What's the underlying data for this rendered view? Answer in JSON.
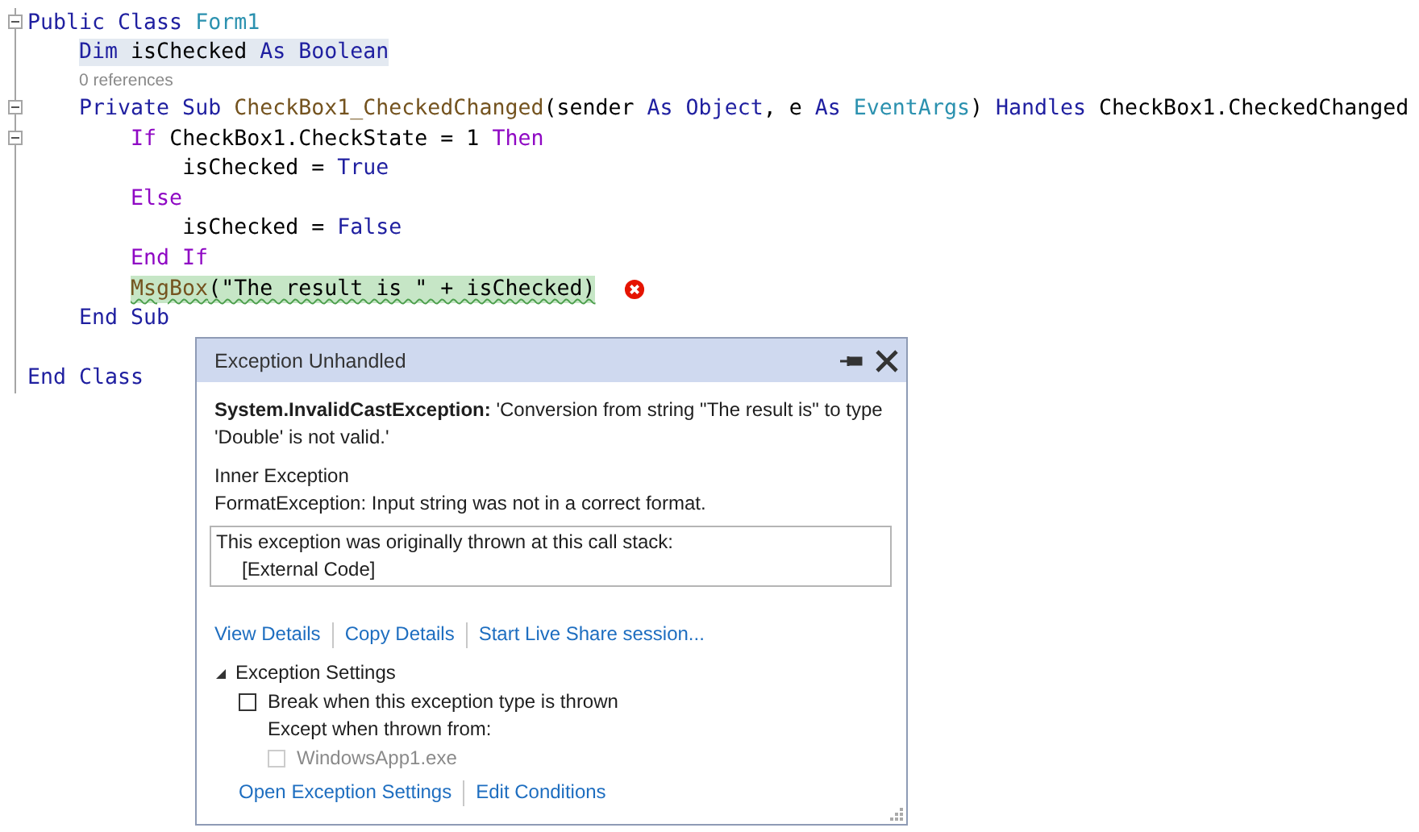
{
  "editor": {
    "lines": [
      {
        "kind": "code",
        "fold": true,
        "tokens": [
          {
            "text": "Public Class ",
            "kind": "keyword"
          },
          {
            "text": "Form1",
            "kind": "type"
          }
        ],
        "children": [
          {
            "kind": "code",
            "reference_highlight": true,
            "tokens": [
              {
                "text": "Dim ",
                "kind": "keyword"
              },
              {
                "text": "isChecked ",
                "kind": "plain"
              },
              {
                "text": "As Boolean",
                "kind": "keyword"
              }
            ]
          },
          {
            "kind": "codelens",
            "text": "0 references"
          },
          {
            "kind": "code",
            "fold": true,
            "tokens": [
              {
                "text": "Private Sub ",
                "kind": "keyword"
              },
              {
                "text": "CheckBox1_CheckedChanged",
                "kind": "method"
              },
              {
                "text": "(sender ",
                "kind": "plain"
              },
              {
                "text": "As Object",
                "kind": "keyword"
              },
              {
                "text": ", e ",
                "kind": "plain"
              },
              {
                "text": "As ",
                "kind": "keyword"
              },
              {
                "text": "EventArgs",
                "kind": "type"
              },
              {
                "text": ") ",
                "kind": "plain"
              },
              {
                "text": "Handles ",
                "kind": "keyword"
              },
              {
                "text": "CheckBox1.CheckedChanged",
                "kind": "plain"
              }
            ],
            "children": [
              {
                "kind": "code",
                "fold": true,
                "tokens": [
                  {
                    "text": "If ",
                    "kind": "control"
                  },
                  {
                    "text": "CheckBox1.CheckState = 1 ",
                    "kind": "plain"
                  },
                  {
                    "text": "Then",
                    "kind": "control"
                  }
                ],
                "children": [
                  {
                    "kind": "code",
                    "tokens": [
                      {
                        "text": "isChecked = ",
                        "kind": "plain"
                      },
                      {
                        "text": "True",
                        "kind": "keyword"
                      }
                    ]
                  }
                ]
              },
              {
                "kind": "code",
                "tokens": [
                  {
                    "text": "Else",
                    "kind": "control"
                  }
                ],
                "children": [
                  {
                    "kind": "code",
                    "tokens": [
                      {
                        "text": "isChecked = ",
                        "kind": "plain"
                      },
                      {
                        "text": "False",
                        "kind": "keyword"
                      }
                    ]
                  }
                ]
              },
              {
                "kind": "code",
                "tokens": [
                  {
                    "text": "End If",
                    "kind": "control"
                  }
                ]
              },
              {
                "kind": "code",
                "exception_line": true,
                "error": true,
                "tokens": [
                  {
                    "text": "MsgBox",
                    "kind": "method"
                  },
                  {
                    "text": "(\"The result is \" + isChecked)",
                    "kind": "plain"
                  }
                ]
              }
            ]
          },
          {
            "kind": "code",
            "tokens": [
              {
                "text": "End Sub",
                "kind": "keyword"
              }
            ]
          },
          {
            "kind": "blank"
          }
        ]
      },
      {
        "kind": "code",
        "tokens": [
          {
            "text": "End Class",
            "kind": "keyword"
          }
        ]
      }
    ]
  },
  "popup": {
    "title": "Exception Unhandled",
    "message": "**System.InvalidCastException:** 'Conversion from string \"The result is\" to type 'Double' is not valid.'",
    "inner_label": "Inner Exception",
    "inner_message": "FormatException: Input string was not in a correct format.",
    "call_stack": {
      "heading": "This exception was originally thrown at this call stack:",
      "frames": [
        "[External Code]"
      ]
    },
    "links": [
      "View Details",
      "Copy Details",
      "Start Live Share session..."
    ],
    "settings": {
      "title": "Exception Settings",
      "expanded": true,
      "options": [
        {
          "label": "Break when this exception type is thrown",
          "checked": false,
          "disabled": false
        }
      ],
      "except_label": "Except when thrown from:",
      "modules": [
        {
          "label": "WindowsApp1.exe",
          "checked": false,
          "disabled": true
        }
      ]
    },
    "footer_links": [
      "Open Exception Settings",
      "Edit Conditions"
    ]
  }
}
